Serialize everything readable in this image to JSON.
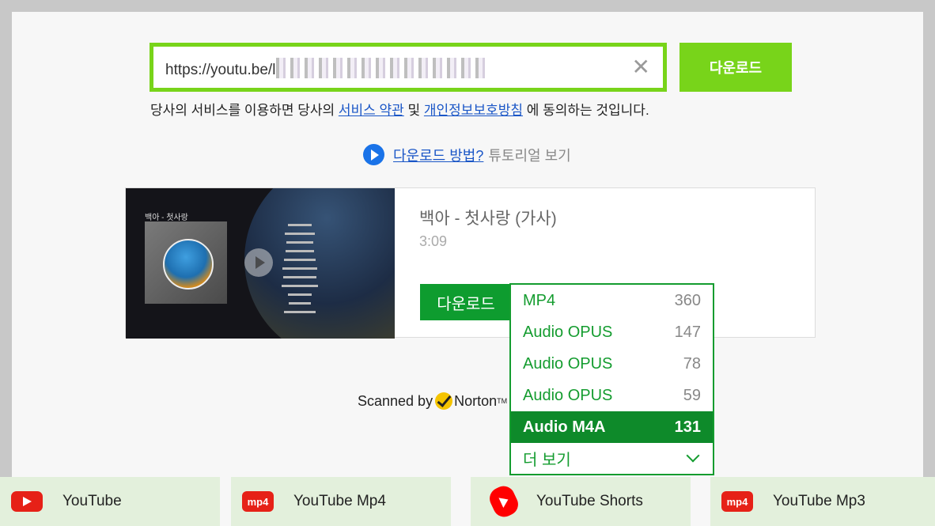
{
  "url_input": {
    "value": "https://youtu.be/l",
    "clear_label": "✕"
  },
  "main_download_label": "다운로드",
  "terms": {
    "prefix": "당사의 서비스를 이용하면 당사의 ",
    "service_terms": "서비스 약관",
    "middle": " 및 ",
    "privacy": "개인정보보호방침",
    "suffix": " 에 동의하는 것입니다."
  },
  "tutorial": {
    "link": "다운로드 방법?",
    "rest": "튜토리얼 보기"
  },
  "video": {
    "title": "백아 - 첫사랑 (가사)",
    "duration": "3:09",
    "thumb_title": "백아 - 첫사랑",
    "download_label": "다운로드"
  },
  "formats": [
    {
      "label": "MP4",
      "quality": "360",
      "selected": false
    },
    {
      "label": "Audio OPUS",
      "quality": "147",
      "selected": false
    },
    {
      "label": "Audio OPUS",
      "quality": "78",
      "selected": false
    },
    {
      "label": "Audio OPUS",
      "quality": "59",
      "selected": false
    },
    {
      "label": "Audio M4A",
      "quality": "131",
      "selected": true
    }
  ],
  "more_label": "더 보기",
  "norton": {
    "prefix": "Scanned by",
    "brand": "Norton",
    "tm": "TM"
  },
  "bottom_tabs": [
    {
      "label": "YouTube",
      "icon": "youtube-icon"
    },
    {
      "label": "YouTube Mp4",
      "icon": "mp4-icon",
      "icon_text": "mp4"
    },
    {
      "label": "YouTube Shorts",
      "icon": "shorts-icon"
    },
    {
      "label": "YouTube Mp3",
      "icon": "mp4-icon",
      "icon_text": "mp4"
    }
  ],
  "colors": {
    "accent": "#78d41a",
    "download_green": "#0e9c2f",
    "selected_row": "#0e8a2a"
  }
}
